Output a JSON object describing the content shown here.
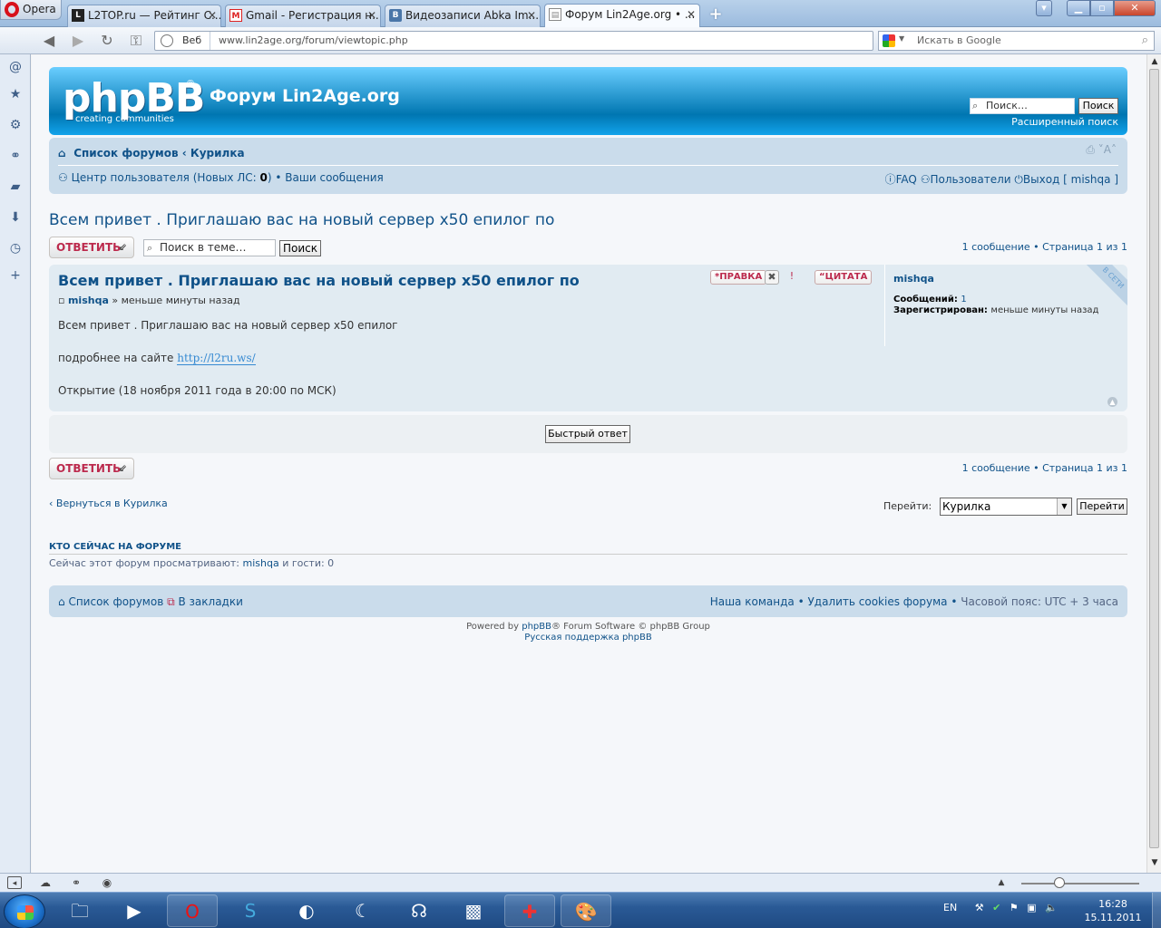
{
  "browser": {
    "opera_label": "Opera",
    "tabs": [
      {
        "title": "L2TOP.ru — Рейтинг С...",
        "favicon": "l2top"
      },
      {
        "title": "Gmail - Регистрация н...",
        "favicon": "gmail"
      },
      {
        "title": "Видеозаписи Abka Im......",
        "favicon": "vk"
      },
      {
        "title": "Форум Lin2Age.org • ...",
        "favicon": "page",
        "active": true
      }
    ],
    "address_prefix": "Веб",
    "url": "www.lin2age.org/forum/viewtopic.php",
    "search_placeholder": "Искать в Google"
  },
  "forum": {
    "logo_word": "phpBB",
    "logo_reg": "®",
    "logo_tag": "creating   communities",
    "site_name": "Форум Lin2Age.org",
    "header_search_placeholder": "Поиск…",
    "header_search_btn": "Поиск",
    "advanced_search": "Расширенный поиск",
    "breadcrumb_index": "Список форумов",
    "breadcrumb_sep": "‹",
    "breadcrumb_forum": "Курилка",
    "ucp_link": "Центр пользователя",
    "ucp_pm_prefix": "(Новых ЛС: ",
    "ucp_pm_count": "0",
    "ucp_pm_suffix": ")",
    "ucp_posts": "Ваши сообщения",
    "faq": "FAQ",
    "members": "Пользователи",
    "logout": "Выход [ mishqa ]",
    "topic_title": "Всем привет . Приглашаю вас на новый сервер x50 епилог по",
    "reply_btn": "ОТВЕТИТЬ",
    "topic_search_placeholder": "Поиск в теме…",
    "topic_search_btn": "Поиск",
    "pagination": "1 сообщение • Страница 1 из 1",
    "post": {
      "title": "Всем привет . Приглашаю вас на новый сервер x50 епилог по",
      "edit_btn": "ПРАВКА",
      "quote_btn": "ЦИТАТА",
      "author": "mishqa",
      "time": "» меньше минуты назад",
      "line1": "Всем привет . Приглашаю вас на новый сервер x50 епилог",
      "line2_prefix": "подробнее на сайте ",
      "line2_url": "http://l2ru.ws/",
      "line3": "Открытие (18 ноября 2011 года в 20:00 по МСК)",
      "profile_name": "mishqa",
      "profile_posts_label": "Сообщений:",
      "profile_posts": "1",
      "profile_reg_label": "Зарегистрирован:",
      "profile_reg": "меньше минуты назад",
      "online_ribbon": "В СЕТИ"
    },
    "quick_reply_btn": "Быстрый ответ",
    "back_link": "Вернуться в Курилка",
    "jump_label": "Перейти:",
    "jump_selected": "Курилка",
    "jump_btn": "Перейти",
    "who_title": "КТО СЕЙЧАС НА ФОРУМЕ",
    "who_prefix": "Сейчас этот форум просматривают: ",
    "who_user": "mishqa",
    "who_suffix": " и гости: 0",
    "footer_index": "Список форумов",
    "footer_bookmarks": "В закладки",
    "footer_team": "Наша команда",
    "footer_cookies": "Удалить cookies форума",
    "footer_timezone": "Часовой пояс: UTC + 3 часа",
    "powered_prefix": "Powered by ",
    "powered_link": "phpBB",
    "powered_suffix": "® Forum Software © phpBB Group",
    "russian_support": "Русская поддержка phpBB"
  },
  "taskbar": {
    "lang": "EN",
    "time": "16:28",
    "date": "15.11.2011"
  },
  "colors": {
    "header_top": "#6aceff",
    "header_bottom": "#0076b1",
    "navpanel": "#cadceb",
    "post_bg": "#e1ebf2",
    "link": "#105289",
    "reply_red": "#bc2a4d"
  }
}
